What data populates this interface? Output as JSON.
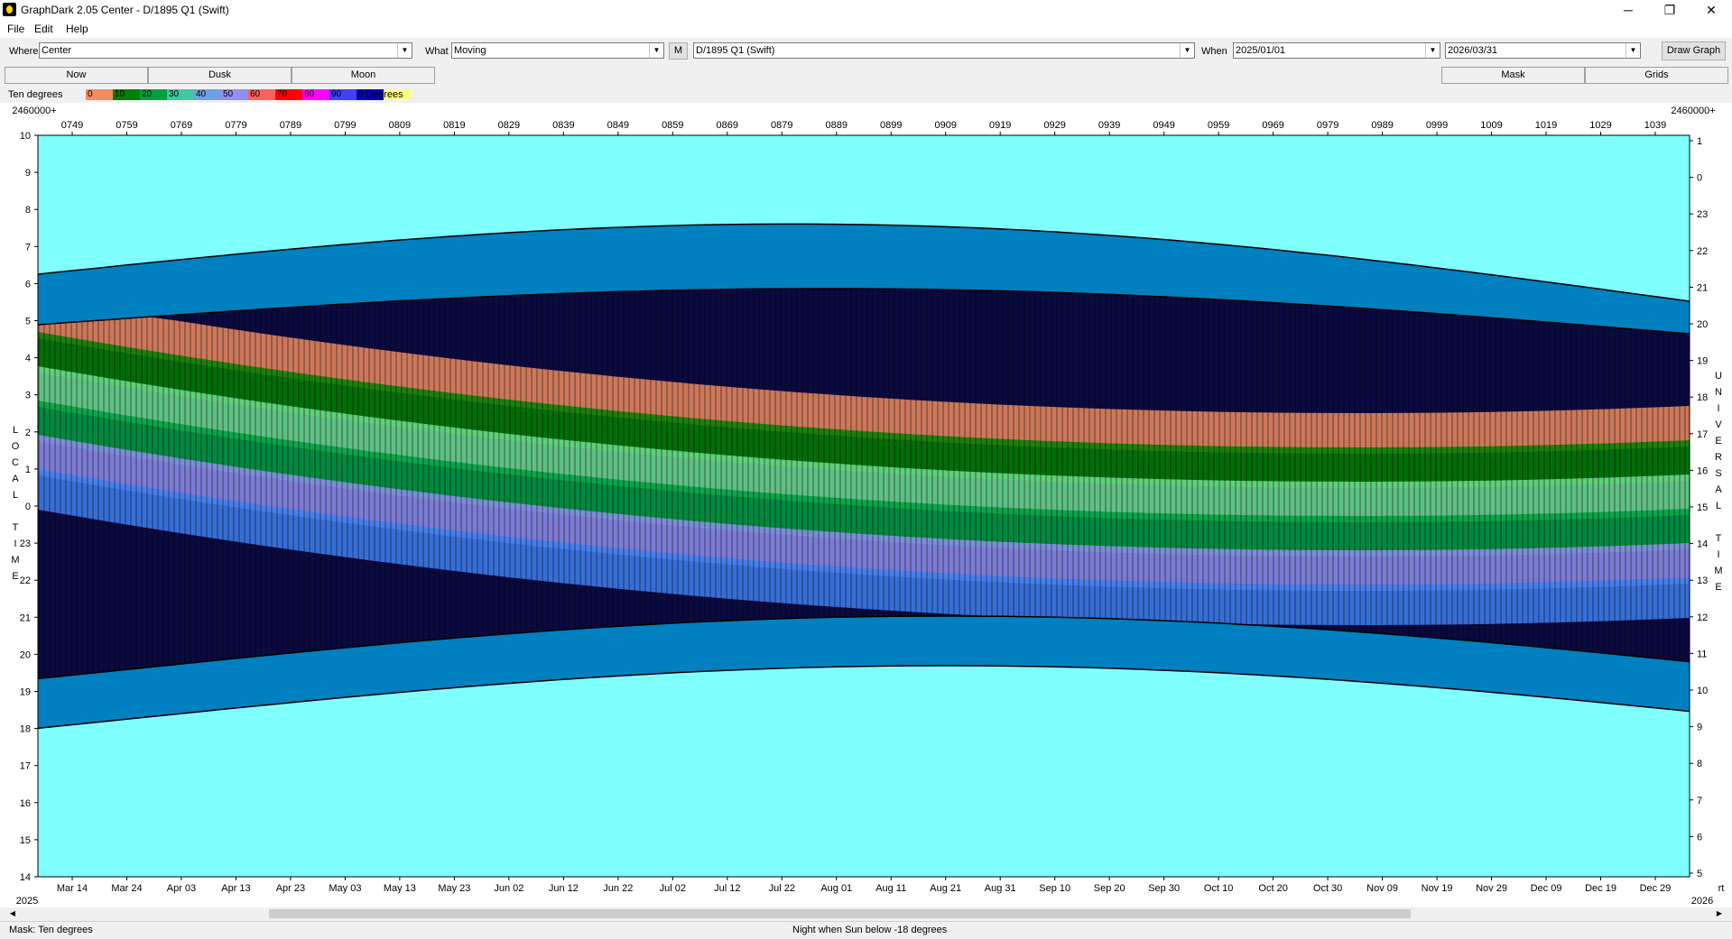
{
  "window": {
    "title": "GraphDark 2.05  Center  -  D/1895 Q1 (Swift)",
    "minimize": "─",
    "maximize": "❐",
    "close": "✕"
  },
  "menu": [
    "File",
    "Edit",
    "Help"
  ],
  "toolbar": {
    "where_label": "Where",
    "where_value": "Center",
    "what_label": "What",
    "what_value": "Moving",
    "m_button": "M",
    "object_value": "D/1895 Q1 (Swift)",
    "when_label": "When",
    "start_date": "2025/01/01",
    "end_date": "2026/03/31",
    "draw_button": "Draw Graph"
  },
  "buttons": {
    "now": "Now",
    "dusk": "Dusk",
    "moon": "Moon",
    "mask": "Mask",
    "grids": "Grids"
  },
  "legend": {
    "title": "Ten degrees",
    "unit": "Degrees",
    "swatches": [
      {
        "label": "0",
        "color": "#f08c60"
      },
      {
        "label": "10",
        "color": "#008000"
      },
      {
        "label": "20",
        "color": "#00a040"
      },
      {
        "label": "30",
        "color": "#40c8a0"
      },
      {
        "label": "40",
        "color": "#70a0e0"
      },
      {
        "label": "50",
        "color": "#9090f0"
      },
      {
        "label": "60",
        "color": "#ff6060"
      },
      {
        "label": "70",
        "color": "#ff0000"
      },
      {
        "label": "80",
        "color": "#ff00ff"
      },
      {
        "label": "90",
        "color": "#4040ff"
      },
      {
        "label": "0",
        "color": "#0000c0"
      },
      {
        "label": "",
        "color": "#ffff80"
      }
    ]
  },
  "chart_data": {
    "type": "heatmap",
    "jd_prefix_left": "2460000+",
    "jd_prefix_right": "2460000+",
    "jd_ticks": [
      "0749",
      "0759",
      "0769",
      "0779",
      "0789",
      "0799",
      "0809",
      "0819",
      "0829",
      "0839",
      "0849",
      "0859",
      "0869",
      "0879",
      "0889",
      "0899",
      "0909",
      "0919",
      "0929",
      "0939",
      "0949",
      "0959",
      "0969",
      "0979",
      "0989",
      "0999",
      "1009",
      "1019",
      "1029",
      "1039"
    ],
    "date_ticks": [
      "Mar 14",
      "Mar 24",
      "Apr 03",
      "Apr 13",
      "Apr 23",
      "May 03",
      "May 13",
      "May 23",
      "Jun 02",
      "Jun 12",
      "Jun 22",
      "Jul 02",
      "Jul 12",
      "Jul 22",
      "Aug 01",
      "Aug 11",
      "Aug 21",
      "Aug 31",
      "Sep 10",
      "Sep 20",
      "Sep 30",
      "Oct 10",
      "Oct 20",
      "Oct 30",
      "Nov 09",
      "Nov 19",
      "Nov 29",
      "Dec 09",
      "Dec 19",
      "Dec 29"
    ],
    "year_left": "2025",
    "year_right": "2026",
    "corner_right": "rt",
    "left_axis_ticks": [
      "10",
      "9",
      "8",
      "7",
      "6",
      "5",
      "4",
      "3",
      "2",
      "1",
      "0",
      "23",
      "22",
      "21",
      "20",
      "19",
      "18",
      "17",
      "16",
      "15",
      "14"
    ],
    "right_axis_ticks": [
      "1",
      "0",
      "23",
      "22",
      "21",
      "20",
      "19",
      "18",
      "17",
      "16",
      "15",
      "14",
      "13",
      "12",
      "11",
      "10",
      "9",
      "8",
      "7",
      "6",
      "5"
    ],
    "left_axis_label": "LOCAL TIME",
    "right_axis_label": "UNIVERSAL TIME",
    "colors": {
      "day": "#80ffff",
      "night": "#0a0a40",
      "twilight": "#0080c0",
      "moon": "#c0c8d8",
      "outline": "#000000"
    }
  },
  "status": {
    "mask": "Mask:  Ten degrees",
    "night": "Night when Sun below -18 degrees"
  },
  "scroll": {
    "left": "◀",
    "right": "▶"
  }
}
